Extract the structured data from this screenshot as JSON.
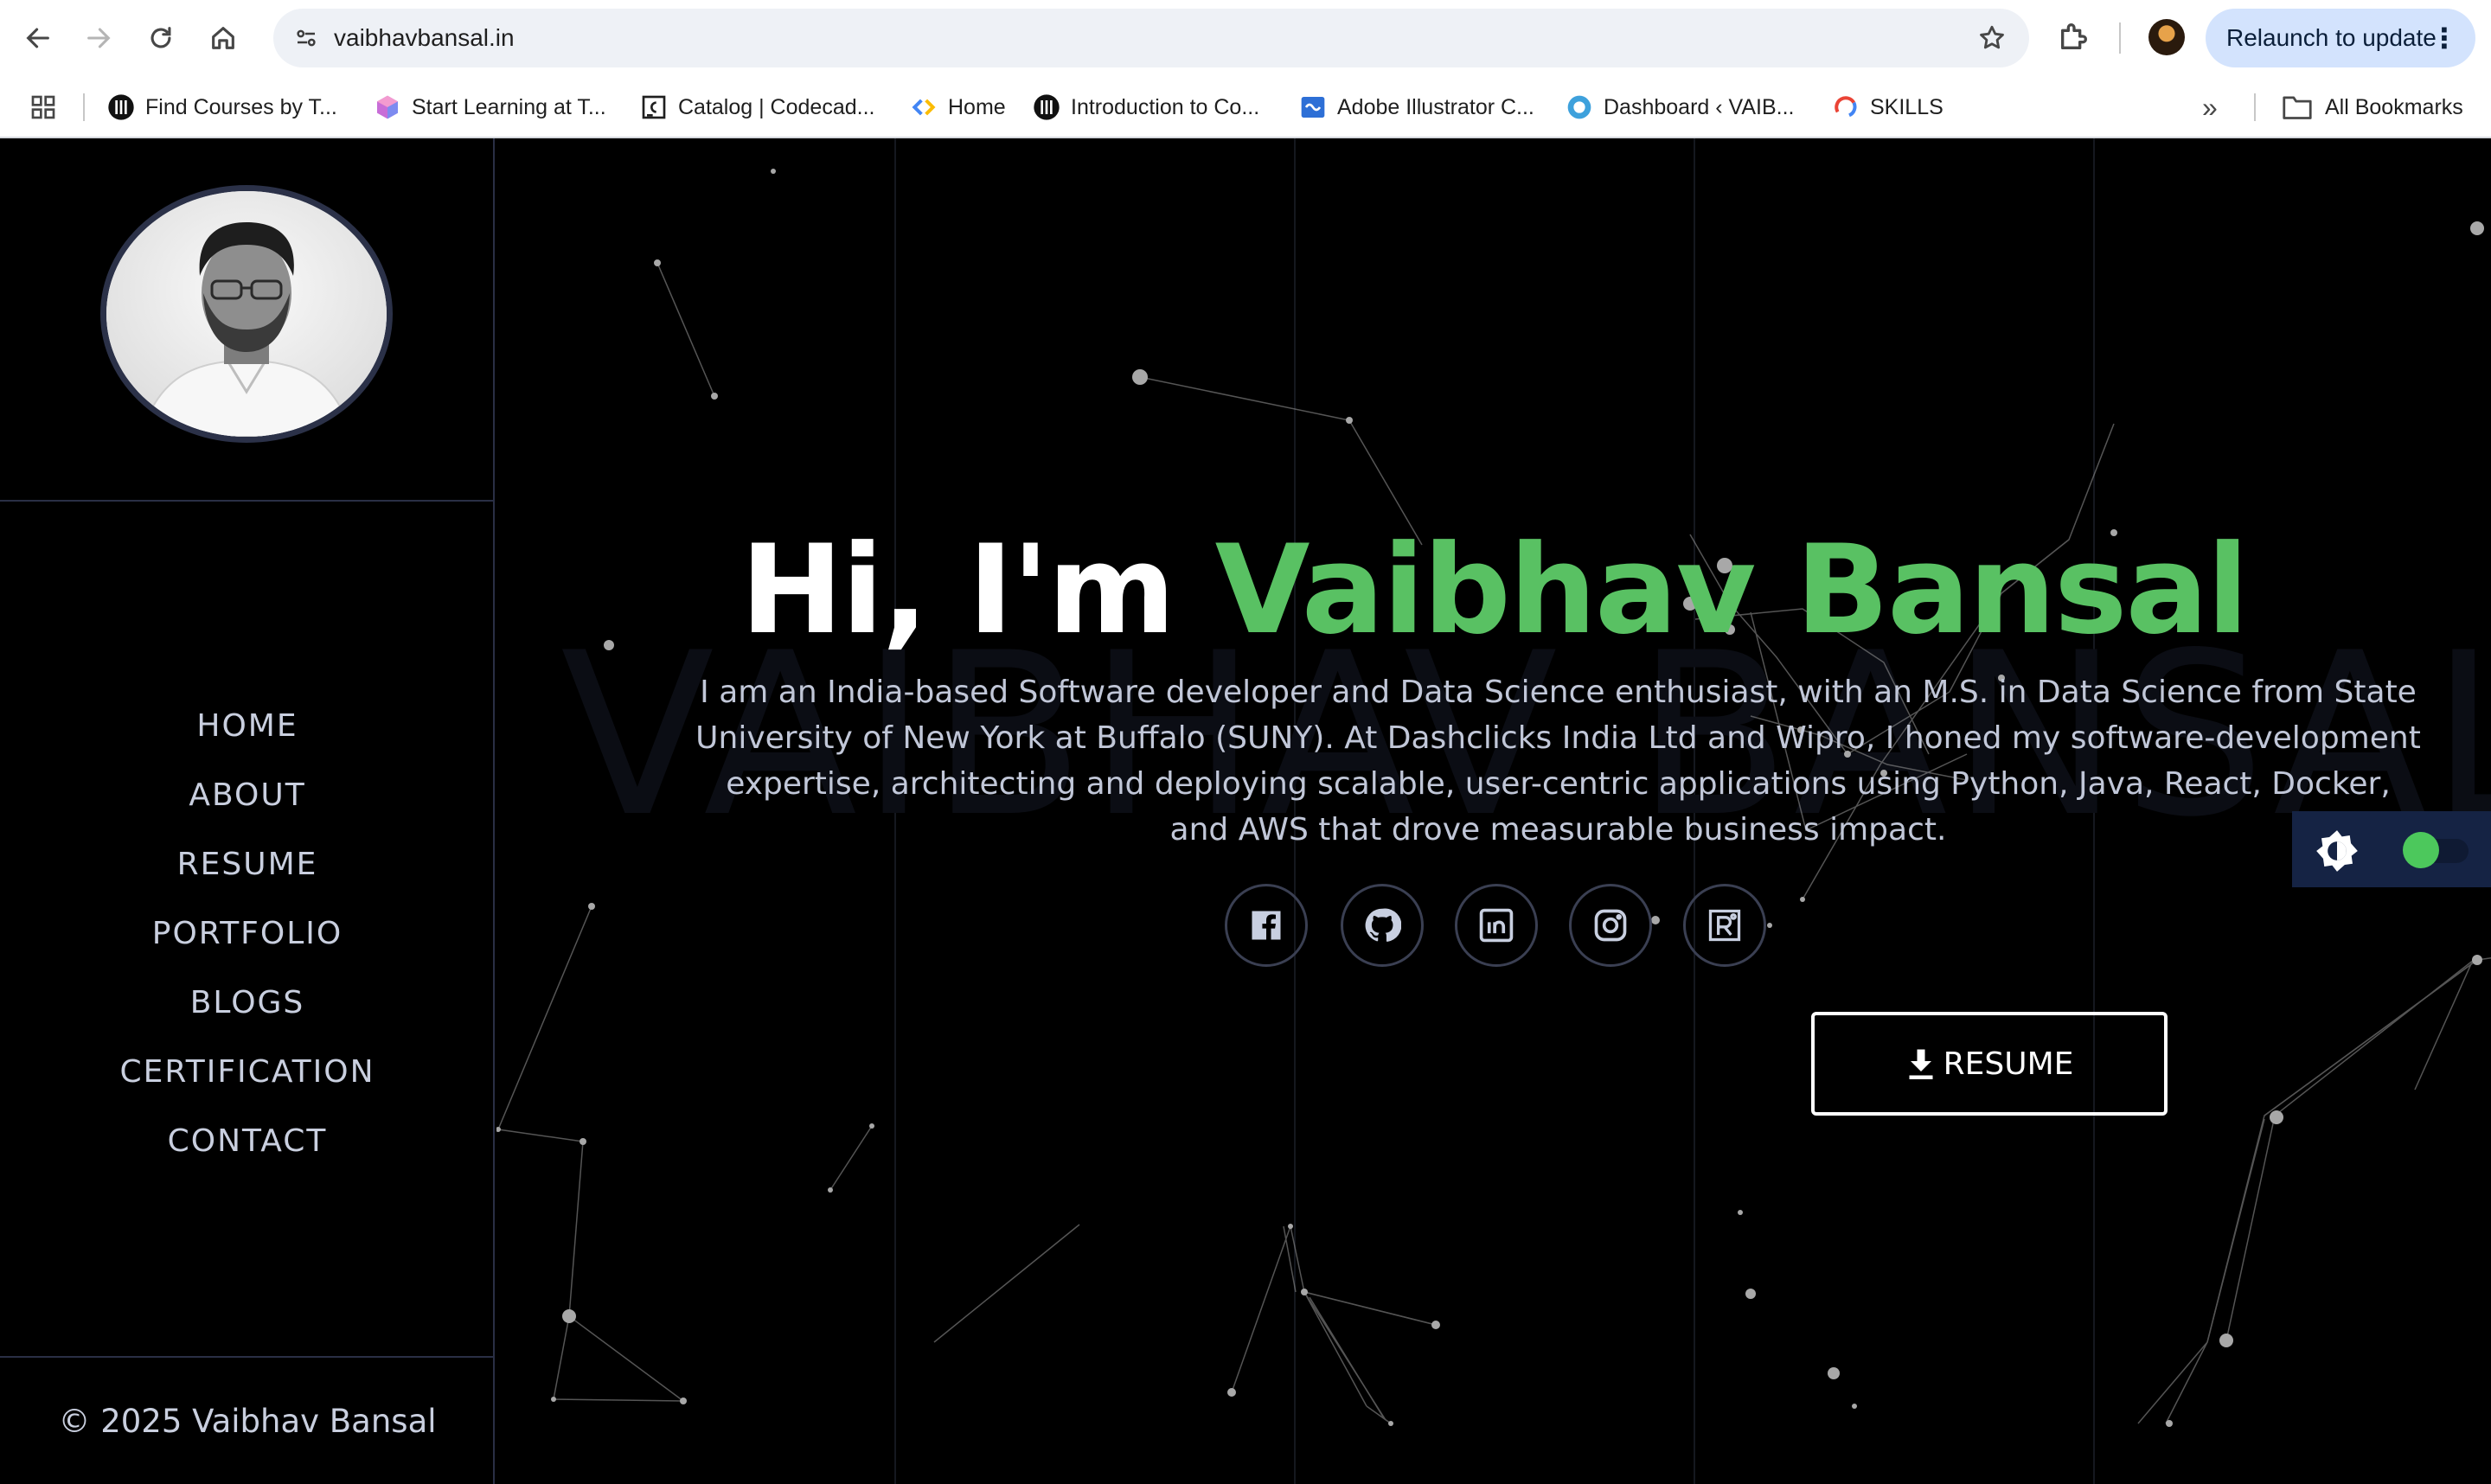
{
  "browser": {
    "url": "vaibhavbansal.in",
    "relaunch_label": "Relaunch to update",
    "bookmarks": [
      "Find Courses by T...",
      "Start Learning at T...",
      "Catalog | Codecad...",
      "Home",
      "Introduction to Co...",
      "Adobe Illustrator C...",
      "Dashboard ‹ VAIB...",
      "SKILLS"
    ],
    "more_bookmarks": "»",
    "all_bookmarks": "All Bookmarks"
  },
  "sidebar": {
    "menu": [
      "HOME",
      "ABOUT",
      "RESUME",
      "PORTFOLIO",
      "BLOGS",
      "CERTIFICATION",
      "CONTACT"
    ],
    "copyright": "© 2025 Vaibhav Bansal"
  },
  "hero": {
    "watermark": "VAIBHAV BANSAL",
    "greeting": "Hi, I'm ",
    "name": "Vaibhav Bansal",
    "description": "I am an India-based Software developer and Data Science enthusiast, with an M.S. in Data Science from State University of New York at Buffalo (SUNY). At Dashclicks India Ltd and Wipro, I honed my software-development expertise, architecting and deploying scalable, user-centric applications using Python, Java, React, Docker, and AWS that drove measurable business impact.",
    "socials": [
      "facebook-icon",
      "github-icon",
      "linkedin-icon",
      "instagram-icon",
      "resume-r-icon"
    ],
    "resume_button": "RESUME",
    "accent_color": "#59c163"
  },
  "theme": {
    "toggle": "on",
    "knob_color": "#4cc85c"
  }
}
